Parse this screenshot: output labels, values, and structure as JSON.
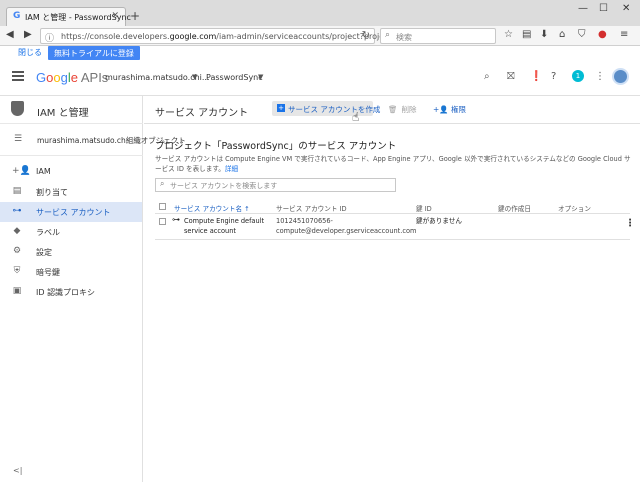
{
  "browser": {
    "tab_title": "IAM と管理 - PasswordSync",
    "url_prefix": "https://console.developers.",
    "url_domain": "google.com",
    "url_suffix": "/iam-admin/serviceaccounts/project?project=pas",
    "search_placeholder": "検索"
  },
  "notification": {
    "close_label": "閉じる",
    "trial_label": "無料トライアルに登録"
  },
  "header": {
    "logo_google": "Google",
    "logo_apis": " APIs",
    "account": "murashima.matsudo.chi...",
    "project": "PasswordSync",
    "badge_count": "1"
  },
  "sidebar": {
    "title": "IAM と管理",
    "org": "murashima.matsudo.ch組織オブジェクト",
    "items": [
      {
        "label": "IAM",
        "icon": "person-add-icon",
        "glyph": "+👤"
      },
      {
        "label": "割り当て",
        "icon": "quota-icon",
        "glyph": "▤"
      },
      {
        "label": "サービス アカウント",
        "icon": "service-account-icon",
        "glyph": "⊶"
      },
      {
        "label": "ラベル",
        "icon": "label-icon",
        "glyph": "◆"
      },
      {
        "label": "設定",
        "icon": "gear-icon",
        "glyph": "⚙"
      },
      {
        "label": "暗号鍵",
        "icon": "key-shield-icon",
        "glyph": "⛨"
      },
      {
        "label": "ID 認識プロキシ",
        "icon": "proxy-icon",
        "glyph": "▣"
      }
    ],
    "collapse_glyph": "<|"
  },
  "main": {
    "page_title": "サービス アカウント",
    "create_label": "サービス アカウントを作成",
    "delete_label": "削除",
    "permissions_label": "権限",
    "heading": "プロジェクト「PasswordSync」のサービス アカウント",
    "description": "サービス アカウントは Compute Engine VM で実行されているコード、App Engine アプリ、Google 以外で実行されているシステムなどの Google Cloud サービス ID を表します。",
    "details_link": "詳細",
    "filter_placeholder": "サービス アカウントを検索します",
    "columns": [
      "サービス アカウント名 ↑",
      "サービス アカウント ID",
      "鍵 ID",
      "鍵の作成日",
      "オプション"
    ],
    "rows": [
      {
        "name_line1": "Compute Engine default",
        "name_line2": "service account",
        "id_line1": "1012451070656-",
        "id_line2": "compute@developer.gserviceaccount.com",
        "key_id": "鍵がありません",
        "key_date": ""
      }
    ]
  },
  "colors": {
    "accent": "#1a73e8",
    "active_nav_bg": "#dce6f7",
    "badge": "#00bcd4"
  }
}
